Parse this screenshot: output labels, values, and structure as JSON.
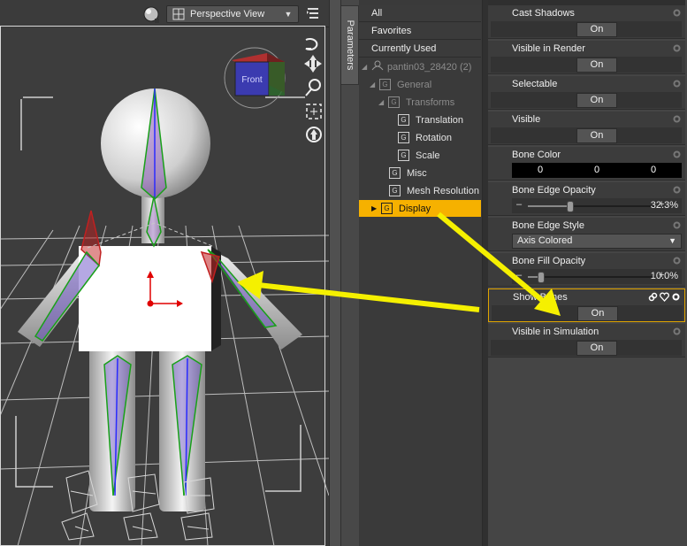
{
  "viewport": {
    "view_label": "Perspective View",
    "cube_label": "Front",
    "icons": [
      "sphere-icon",
      "grid-icon",
      "chevron-down-icon",
      "menu-lines-icon",
      "orbit-icon",
      "pan-icon",
      "zoom-icon",
      "frame-icon",
      "reset-icon"
    ]
  },
  "tab": {
    "parameters": "Parameters"
  },
  "filters": [
    "All",
    "Favorites",
    "Currently Used"
  ],
  "tree": {
    "root": "pantin03_28420 (2)",
    "items": [
      {
        "label": "General",
        "indent": 1,
        "expanded": true,
        "dim": true
      },
      {
        "label": "Transforms",
        "indent": 2,
        "expanded": true,
        "dim": true
      },
      {
        "label": "Translation",
        "indent": 3
      },
      {
        "label": "Rotation",
        "indent": 3
      },
      {
        "label": "Scale",
        "indent": 3
      },
      {
        "label": "Misc",
        "indent": 2
      },
      {
        "label": "Mesh Resolution",
        "indent": 2
      },
      {
        "label": "Display",
        "indent": 0,
        "selected": true
      }
    ],
    "group_icon": "G"
  },
  "params": {
    "cast_shadows": {
      "title": "Cast Shadows",
      "value": "On"
    },
    "visible_in_render": {
      "title": "Visible in Render",
      "value": "On"
    },
    "selectable": {
      "title": "Selectable",
      "value": "On"
    },
    "visible": {
      "title": "Visible",
      "value": "On"
    },
    "bone_color": {
      "title": "Bone Color",
      "r": "0",
      "g": "0",
      "b": "0"
    },
    "bone_edge_opacity": {
      "title": "Bone Edge Opacity",
      "value": "32.3%",
      "fraction": 0.323,
      "minus": "–",
      "plus": "+"
    },
    "bone_edge_style": {
      "title": "Bone Edge Style",
      "value": "Axis Colored"
    },
    "bone_fill_opacity": {
      "title": "Bone Fill Opacity",
      "value": "10.0%",
      "fraction": 0.1,
      "minus": "–",
      "plus": "+"
    },
    "show_bones": {
      "title": "Show Bones",
      "value": "On"
    },
    "visible_in_simulation": {
      "title": "Visible in Simulation",
      "value": "On"
    }
  },
  "colors": {
    "selection": "#f6b100",
    "annotation_arrow": "#f5f000",
    "highlight_border": "#e0a400"
  }
}
